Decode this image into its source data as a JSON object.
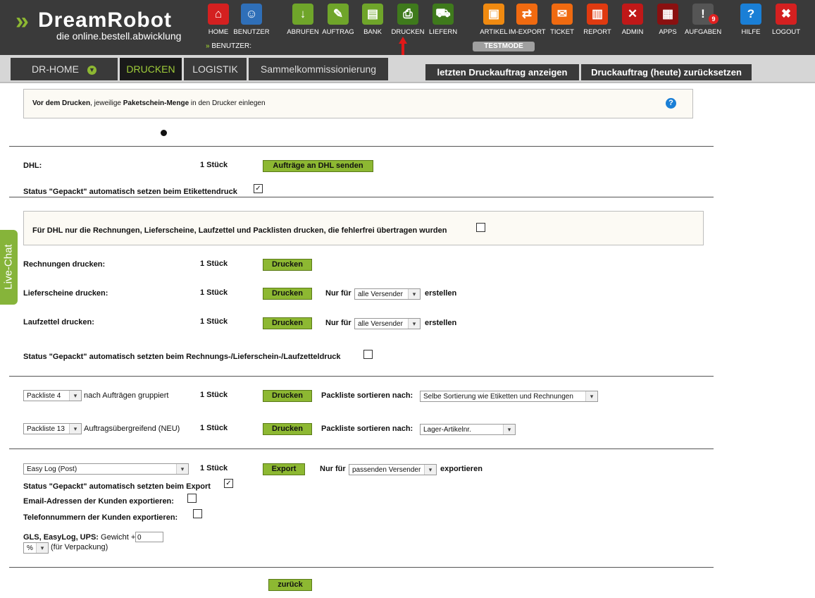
{
  "brand": {
    "name": "DreamRobot",
    "tagline": "die online.bestell.abwicklung",
    "accent": "#8db832"
  },
  "nav": [
    {
      "label": "HOME",
      "icon": "home-icon",
      "color": "#d42020",
      "glyph": "⌂"
    },
    {
      "label": "BENUTZER",
      "icon": "user-icon",
      "color": "#2f6fb8",
      "glyph": "☺"
    },
    {
      "label": "ABRUFEN",
      "icon": "download-icon",
      "color": "#6fa52a",
      "glyph": "↓"
    },
    {
      "label": "AUFTRAG",
      "icon": "order-icon",
      "color": "#6fa52a",
      "glyph": "✎"
    },
    {
      "label": "BANK",
      "icon": "bank-icon",
      "color": "#6fa52a",
      "glyph": "▤"
    },
    {
      "label": "DRUCKEN",
      "icon": "printer-icon",
      "color": "#3f7a1c",
      "glyph": "⎙"
    },
    {
      "label": "LIEFERN",
      "icon": "delivery-icon",
      "color": "#3f7a1c",
      "glyph": "⛟"
    },
    {
      "label": "ARTIKEL",
      "icon": "box-icon",
      "color": "#f08a10",
      "glyph": "▣"
    },
    {
      "label": "IM-EXPORT",
      "icon": "sync-icon",
      "color": "#f06a10",
      "glyph": "⇄"
    },
    {
      "label": "TICKET",
      "icon": "mail-icon",
      "color": "#f06a10",
      "glyph": "✉"
    },
    {
      "label": "REPORT",
      "icon": "chart-icon",
      "color": "#e03a10",
      "glyph": "▥"
    },
    {
      "label": "ADMIN",
      "icon": "tools-icon",
      "color": "#c01818",
      "glyph": "✕"
    },
    {
      "label": "APPS",
      "icon": "apps-icon",
      "color": "#8a1010",
      "glyph": "▦"
    },
    {
      "label": "AUFGABEN",
      "icon": "tasks-icon",
      "color": "#555555",
      "glyph": "!",
      "badge": "9"
    },
    {
      "label": "HILFE",
      "icon": "help-icon",
      "color": "#1a7fd6",
      "glyph": "?"
    },
    {
      "label": "LOGOUT",
      "icon": "logout-icon",
      "color": "#d42020",
      "glyph": "✖"
    }
  ],
  "benutzer_label": "BENUTZER:",
  "testmode": "TESTMODE",
  "tabs": {
    "home": "DR-HOME",
    "drucken": "DRUCKEN",
    "logistik": "LOGISTIK",
    "sammel": "Sammelkommissionierung"
  },
  "right_tabs": {
    "last": "letzten Druckauftrag anzeigen",
    "reset": "Druckauftrag (heute) zurücksetzen"
  },
  "info": {
    "p1": "Vor dem Drucken",
    "p2": ", jeweilige ",
    "p3": "Paketschein-Menge",
    "p4": " in den Drucker einlegen"
  },
  "dhl": {
    "label": "DHL:",
    "count": "1 Stück",
    "button": "Aufträge an DHL senden",
    "status_label": "Status \"Gepackt\" automatisch setzen beim Etikettendruck"
  },
  "dhl_notice": "Für DHL nur die Rechnungen, Lieferscheine, Laufzettel und Packlisten drucken, die fehlerfrei übertragen wurden",
  "rechnungen": {
    "label": "Rechnungen drucken",
    "count": "1 Stück",
    "button": "Drucken"
  },
  "lieferscheine": {
    "label": "Lieferscheine drucken",
    "count": "1 Stück",
    "button": "Drucken",
    "nur_fuer": "Nur für",
    "select": "alle Versender",
    "suffix": "erstellen"
  },
  "laufzettel": {
    "label": "Laufzettel drucken",
    "count": "1 Stück",
    "button": "Drucken",
    "nur_fuer": "Nur für",
    "select": "alle Versender",
    "suffix": "erstellen"
  },
  "status_rechnung": "Status \"Gepackt\" automatisch setzten beim Rechnungs-/Lieferschein-/Laufzetteldruck",
  "packliste1": {
    "select": "Packliste 4",
    "desc": "nach Aufträgen gruppiert",
    "count": "1 Stück",
    "button": "Drucken",
    "sort_label": "Packliste sortieren nach:",
    "sort": "Selbe Sortierung wie Etiketten und Rechnungen"
  },
  "packliste2": {
    "select": "Packliste 13",
    "desc": "Auftragsübergreifend (NEU)",
    "count": "1 Stück",
    "button": "Drucken",
    "sort_label": "Packliste sortieren nach:",
    "sort": "Lager-Artikelnr."
  },
  "export": {
    "select": "Easy Log (Post)",
    "count": "1 Stück",
    "button": "Export",
    "nur_fuer": "Nur für",
    "versender": "passenden Versender",
    "suffix": "exportieren",
    "status_label": "Status \"Gepackt\" automatisch setzten beim Export",
    "email_label": "Email-Adressen der Kunden exportieren:",
    "phone_label": "Telefonnummern der Kunden exportieren:",
    "gewicht_bold": "GLS, EasyLog, UPS:",
    "gewicht_label": "Gewicht +",
    "gewicht_value": "0",
    "unit": "%",
    "unit_suffix": "(für Verpackung)"
  },
  "zurueck": "zurück",
  "livechat": "Live-Chat"
}
